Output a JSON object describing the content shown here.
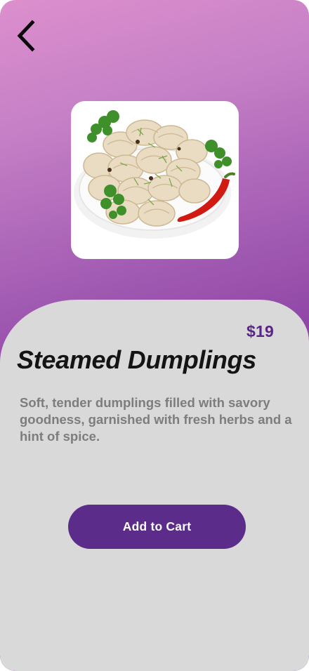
{
  "header": {
    "back_icon": "chevron-left-icon"
  },
  "product": {
    "image_subject": "plate-of-steamed-dumplings",
    "price": "$19",
    "name": "Steamed Dumplings",
    "description": "Soft, tender dumplings filled with savory goodness, garnished with fresh herbs and a hint of spice."
  },
  "actions": {
    "add_to_cart_label": "Add to Cart"
  },
  "colors": {
    "gradient_top": "#dd8fcd",
    "gradient_bottom": "#8a40a2",
    "sheet_background": "#d9d9d9",
    "accent_purple": "#5b2c8a",
    "price_color": "#5a2586",
    "description_color": "#7d7d7d"
  }
}
